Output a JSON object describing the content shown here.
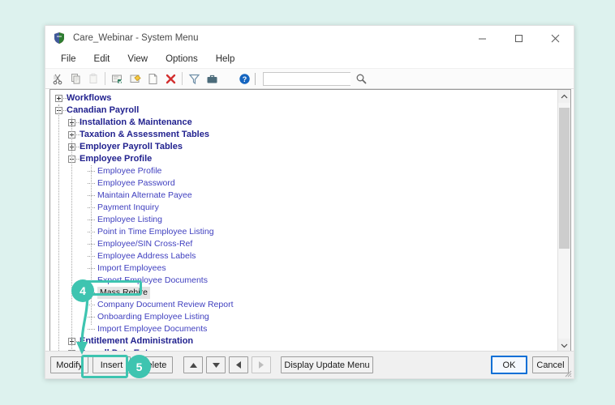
{
  "window": {
    "title": "Care_Webinar - System Menu",
    "app_icon": "shield-icon",
    "controls": {
      "minimize": "minimize-icon",
      "maximize": "maximize-icon",
      "close": "close-icon"
    }
  },
  "menubar": {
    "items": [
      {
        "label": "File"
      },
      {
        "label": "Edit"
      },
      {
        "label": "View"
      },
      {
        "label": "Options"
      },
      {
        "label": "Help"
      }
    ]
  },
  "toolbar": {
    "icons": [
      "cut-icon",
      "copy-icon",
      "paste-icon",
      "save-icon",
      "open-folder-icon",
      "new-document-icon",
      "delete-icon",
      "filter-icon",
      "briefcase-icon",
      "help-icon"
    ],
    "search": {
      "value": "",
      "placeholder": "",
      "icon": "search-icon"
    }
  },
  "tree": {
    "nodes": [
      {
        "label": "Workflows",
        "level": 0,
        "bold": true,
        "toggle": "plus",
        "selected": false
      },
      {
        "label": "Canadian Payroll",
        "level": 0,
        "bold": true,
        "toggle": "minus",
        "selected": false
      },
      {
        "label": "Installation & Maintenance",
        "level": 1,
        "bold": true,
        "toggle": "plus",
        "selected": false
      },
      {
        "label": "Taxation & Assessment Tables",
        "level": 1,
        "bold": true,
        "toggle": "plus",
        "selected": false
      },
      {
        "label": "Employer Payroll Tables",
        "level": 1,
        "bold": true,
        "toggle": "plus",
        "selected": false
      },
      {
        "label": "Employee Profile",
        "level": 1,
        "bold": true,
        "toggle": "minus",
        "selected": false
      },
      {
        "label": "Employee Profile",
        "level": 2,
        "bold": false,
        "toggle": "none",
        "selected": false
      },
      {
        "label": "Employee Password",
        "level": 2,
        "bold": false,
        "toggle": "none",
        "selected": false
      },
      {
        "label": "Maintain Alternate Payee",
        "level": 2,
        "bold": false,
        "toggle": "none",
        "selected": false
      },
      {
        "label": "Payment Inquiry",
        "level": 2,
        "bold": false,
        "toggle": "none",
        "selected": false
      },
      {
        "label": "Employee Listing",
        "level": 2,
        "bold": false,
        "toggle": "none",
        "selected": false
      },
      {
        "label": "Point in Time Employee Listing",
        "level": 2,
        "bold": false,
        "toggle": "none",
        "selected": false
      },
      {
        "label": "Employee/SIN Cross-Ref",
        "level": 2,
        "bold": false,
        "toggle": "none",
        "selected": false
      },
      {
        "label": "Employee Address Labels",
        "level": 2,
        "bold": false,
        "toggle": "none",
        "selected": false
      },
      {
        "label": "Import Employees",
        "level": 2,
        "bold": false,
        "toggle": "none",
        "selected": false
      },
      {
        "label": "Export Employee Documents",
        "level": 2,
        "bold": false,
        "toggle": "none",
        "selected": false
      },
      {
        "label": "Mass Rehire",
        "level": 2,
        "bold": false,
        "toggle": "none",
        "selected": true
      },
      {
        "label": "Company Document Review Report",
        "level": 2,
        "bold": false,
        "toggle": "none",
        "selected": false
      },
      {
        "label": "Onboarding Employee Listing",
        "level": 2,
        "bold": false,
        "toggle": "none",
        "selected": false
      },
      {
        "label": "Import Employee Documents",
        "level": 2,
        "bold": false,
        "toggle": "none",
        "selected": false
      },
      {
        "label": "Entitlement Administration",
        "level": 1,
        "bold": true,
        "toggle": "plus",
        "selected": false
      },
      {
        "label": "Payroll Data Entry",
        "level": 1,
        "bold": true,
        "toggle": "plus",
        "selected": false
      }
    ]
  },
  "buttons": {
    "modify": "Modify",
    "insert": "Insert",
    "delete": "Delete",
    "up": "▲",
    "down": "▼",
    "left": "◄",
    "right": "►",
    "display_update_menu": "Display Update Menu",
    "ok": "OK",
    "cancel": "Cancel"
  },
  "annotations": {
    "step4": "4",
    "step5": "5",
    "accent": "#3ec4b0"
  }
}
